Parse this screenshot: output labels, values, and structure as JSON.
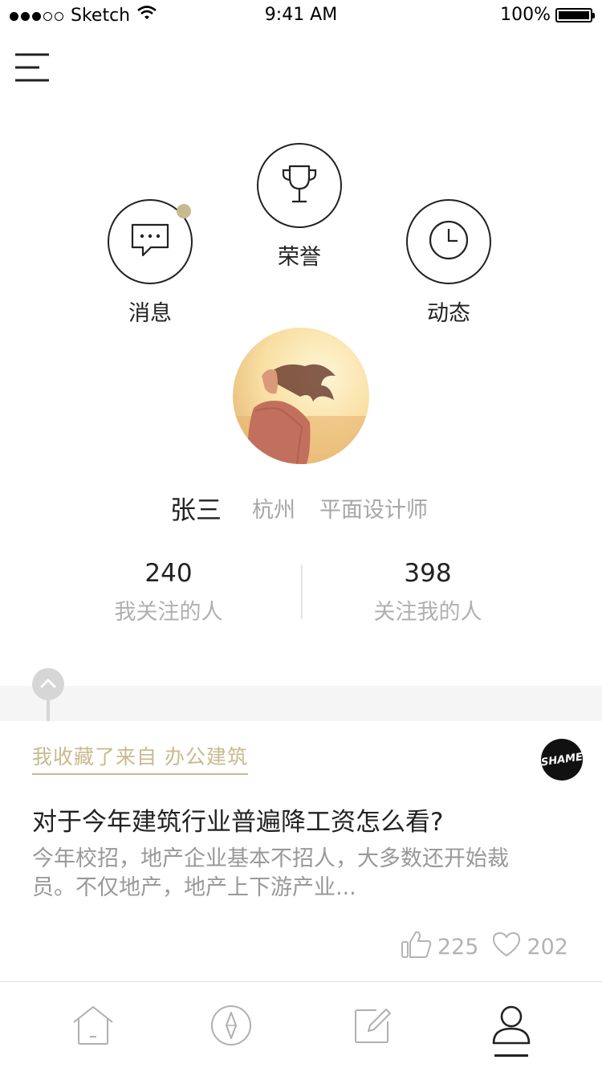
{
  "status_bar": {
    "carrier": "Sketch",
    "time": "9:41 AM",
    "battery": "100%"
  },
  "header": {
    "menu_icon": "hamburger-menu-icon"
  },
  "quick_actions": [
    {
      "label": "消息",
      "icon": "chat-bubble-icon",
      "has_badge": true
    },
    {
      "label": "荣誉",
      "icon": "trophy-icon",
      "has_badge": false
    },
    {
      "label": "动态",
      "icon": "clock-icon",
      "has_badge": false
    }
  ],
  "profile": {
    "name": "张三",
    "city": "杭州",
    "job": "平面设计师"
  },
  "stats": {
    "following_count": "240",
    "following_label": "我关注的人",
    "followers_count": "398",
    "followers_label": "关注我的人"
  },
  "feed": {
    "favorite_label": "我收藏了来自 办公建筑",
    "source_logo_text": "SHAME",
    "title": "对于今年建筑行业普遍降工资怎么看?",
    "description": "今年校招，地产企业基本不招人，大多数还开始裁员。不仅地产，地产上下游产业...",
    "likes": "225",
    "favorites": "202"
  },
  "tabbar": {
    "tabs": [
      {
        "icon": "home-icon",
        "active": false
      },
      {
        "icon": "compass-icon",
        "active": false
      },
      {
        "icon": "edit-icon",
        "active": false
      },
      {
        "icon": "user-icon",
        "active": true
      }
    ]
  },
  "colors": {
    "accent": "#c9b98e",
    "text": "#222222",
    "muted": "#a6a6a6"
  }
}
